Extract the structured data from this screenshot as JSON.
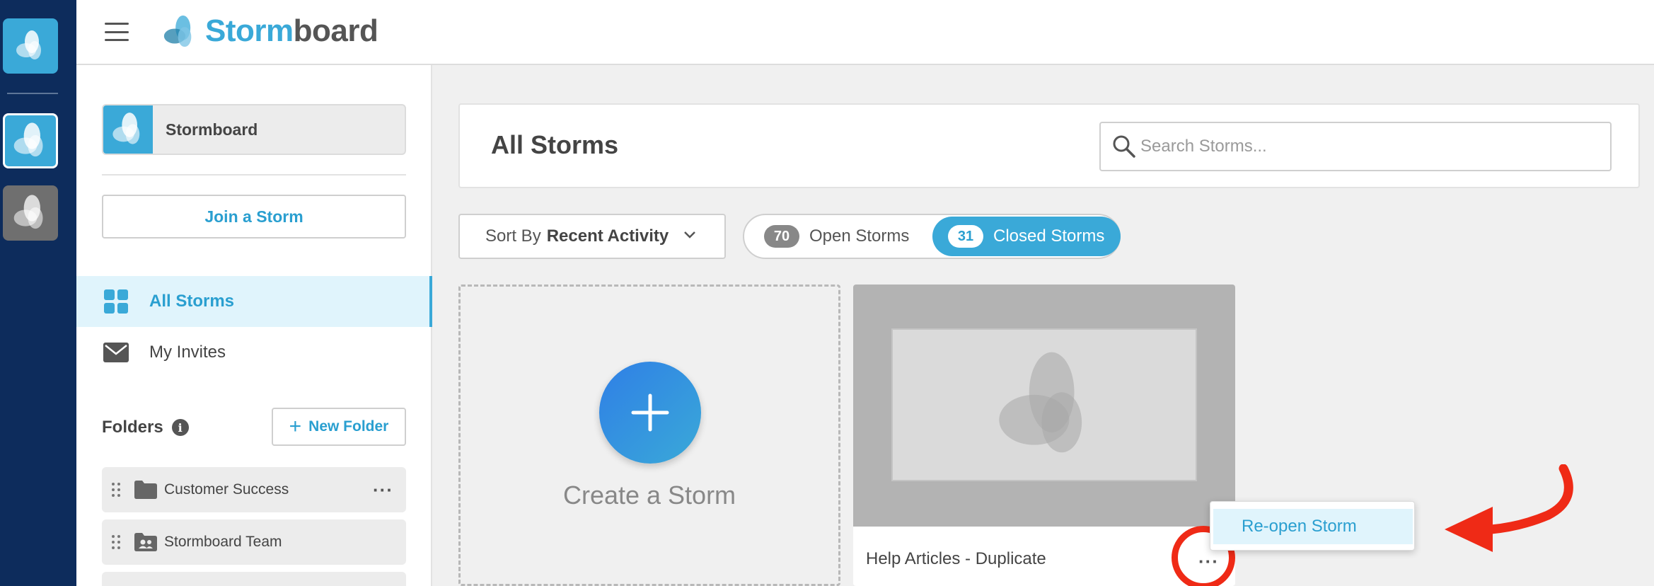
{
  "app": {
    "name_part1": "Storm",
    "name_part2": "board"
  },
  "rail": {
    "items": [
      {
        "icon": "stormboard-logo-icon",
        "color": "#3aa9d8"
      },
      {
        "icon": "stormboard-logo-icon",
        "color": "#3aa9d8",
        "selected": true
      },
      {
        "icon": "stormboard-logo-icon",
        "color": "#6f6f6f"
      }
    ]
  },
  "sidebar": {
    "team_name": "Stormboard",
    "join_label": "Join a Storm",
    "nav": [
      {
        "label": "All Storms",
        "icon": "grid-icon",
        "active": true
      },
      {
        "label": "My Invites",
        "icon": "envelope-icon",
        "active": false
      }
    ],
    "folders_title": "Folders",
    "new_folder_label": "New Folder",
    "folders": [
      {
        "label": "Customer Success",
        "icon": "folder-icon"
      },
      {
        "label": "Stormboard Team",
        "icon": "shared-folder-icon"
      }
    ]
  },
  "main": {
    "title": "All Storms",
    "search_placeholder": "Search Storms...",
    "sort_prefix": "Sort By",
    "sort_value": "Recent Activity",
    "open_count": "70",
    "open_label": "Open Storms",
    "closed_count": "31",
    "closed_label": "Closed Storms",
    "create_label": "Create a Storm",
    "storm_card_title": "Help Articles - Duplicate",
    "menu_item": "Re-open Storm"
  },
  "colors": {
    "brand": "#3aa9d8",
    "rail": "#0d2c5c",
    "annotation": "#ef2a16"
  }
}
